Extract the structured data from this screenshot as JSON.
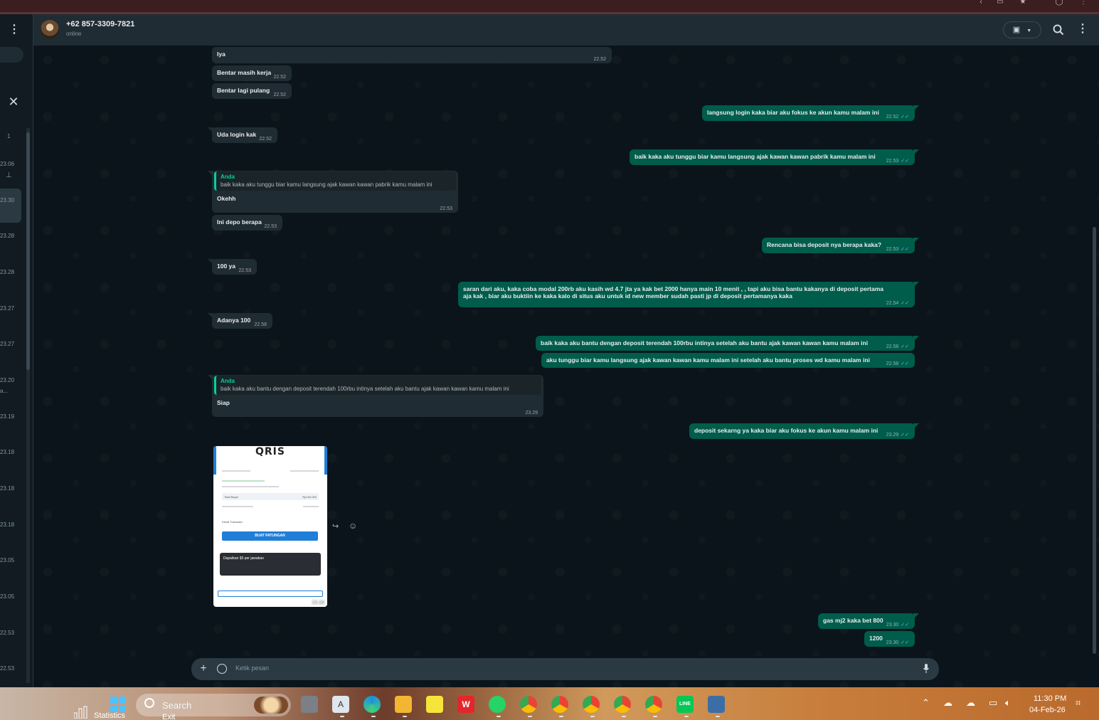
{
  "header": {
    "contact_name": "+62 857-3309-7821",
    "status": "online",
    "icons": [
      "video-call-icon",
      "search-icon",
      "menu-icon"
    ]
  },
  "left_panel": {
    "times": [
      "1",
      "23.06",
      "23.30",
      "23.28",
      "23.28",
      "23.27",
      "23.27",
      "23.20",
      "a...",
      "23.19",
      "23.18",
      "23.18",
      "23.18",
      "23.05",
      "23.05",
      "22.53",
      "22.53"
    ]
  },
  "messages": [
    {
      "dir": "in",
      "text": "Iya",
      "time": "22.52"
    },
    {
      "dir": "in",
      "text": "Bentar masih kerja",
      "time": "22.52"
    },
    {
      "dir": "in",
      "text": "Bentar lagi pulang",
      "time": "22.52"
    },
    {
      "dir": "out",
      "text": "langsung login kaka biar aku fokus ke akun kamu malam ini",
      "time": "22.52"
    },
    {
      "dir": "in",
      "text": "Uda login kak",
      "time": "22.52"
    },
    {
      "dir": "out",
      "text": "baik kaka aku tunggu biar kamu langsung ajak kawan kawan pabrik kamu malam ini",
      "time": "22.53"
    },
    {
      "dir": "in",
      "quote_author": "Anda",
      "quote_text": "baik kaka aku tunggu biar kamu langsung ajak kawan kawan pabrik kamu malam ini",
      "text": "Okehh",
      "time": "22.53"
    },
    {
      "dir": "in",
      "text": "Ini depo berapa",
      "time": "22.53"
    },
    {
      "dir": "out",
      "text": "Rencana bisa deposit nya berapa kaka?",
      "time": "22.53"
    },
    {
      "dir": "in",
      "text": "100 ya",
      "time": "22.53"
    },
    {
      "dir": "out",
      "text": "saran dari aku, kaka coba modal 200rb aku kasih wd 4.7 jta ya kak bet 2000 hanya main 10 menit , , tapi aku bisa bantu kakanya di deposit pertama",
      "text2": "aja kak , biar aku buktiin ke kaka kalo di situs aku untuk id new member sudah pasti jp di deposit pertamanya kaka",
      "time": "22.54"
    },
    {
      "dir": "in",
      "text": "Adanya 100",
      "time": "22.58"
    },
    {
      "dir": "out",
      "text": "baik kaka aku bantu dengan deposit  terendah 100rbu intinya setelah aku bantu ajak kawan kawan kamu malam ini",
      "time": "22.58"
    },
    {
      "dir": "out",
      "text": "aku tunggu biar kamu langsung ajak kawan kawan kamu malam ini setelah aku bantu proses wd kamu malam ini",
      "time": "22.58"
    },
    {
      "dir": "in",
      "quote_author": "Anda",
      "quote_text": "baik kaka aku bantu dengan deposit  terendah 100rbu intinya setelah aku bantu ajak kawan kawan kamu malam ini",
      "text": "Siap",
      "time": "23.29"
    },
    {
      "dir": "out",
      "text": "deposit sekarng ya kaka biar aku fokus ke akun kamu malam ini",
      "time": "23.29"
    },
    {
      "dir": "out",
      "text": "gas mj2 kaka bet 800",
      "time": "23.30"
    },
    {
      "dir": "out",
      "text": "1200",
      "time": "23.30"
    }
  ],
  "image_message": {
    "logo": "QRIS",
    "button": "BUAT PATUNGAN",
    "card_title": "Dapatkan $5 per jawaban",
    "section": "Detail Transaksi",
    "total_label": "Total Bayar",
    "amount": "Rp100.000",
    "time": "23.30"
  },
  "input": {
    "placeholder": "Ketik pesan"
  },
  "taskbar": {
    "search_label": "Search",
    "stat_label": "Statistics",
    "exit_label": "Exit",
    "time": "11:30 PM",
    "date": "04-Feb-26"
  },
  "colors": {
    "outgoing_bubble": "#005c4b",
    "incoming_bubble": "#202c33",
    "chat_bg": "#0b141a",
    "accent": "#06cf9c",
    "tick": "#53bdeb"
  }
}
